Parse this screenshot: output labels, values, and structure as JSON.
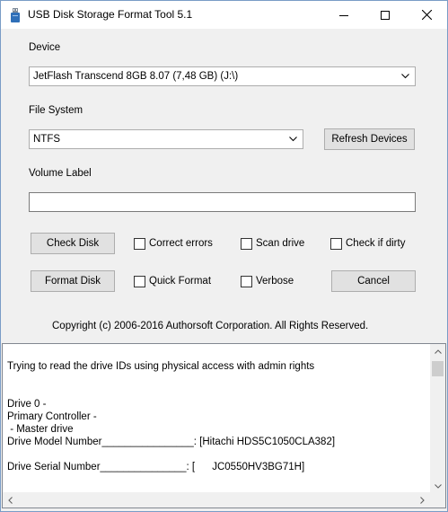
{
  "window": {
    "title": "USB Disk Storage Format Tool 5.1"
  },
  "form": {
    "device_label": "Device",
    "device_value": "JetFlash  Transcend 8GB  8.07 (7,48 GB) (J:\\)",
    "filesystem_label": "File System",
    "filesystem_value": "NTFS",
    "refresh_button": "Refresh Devices",
    "volume_label": "Volume Label",
    "volume_value": "",
    "check_disk_button": "Check Disk",
    "format_disk_button": "Format Disk",
    "cancel_button": "Cancel",
    "options": {
      "correct_errors": {
        "label": "Correct errors",
        "checked": false
      },
      "scan_drive": {
        "label": "Scan drive",
        "checked": false
      },
      "check_if_dirty": {
        "label": "Check if dirty",
        "checked": false
      },
      "quick_format": {
        "label": "Quick Format",
        "checked": false
      },
      "verbose": {
        "label": "Verbose",
        "checked": false
      }
    },
    "copyright": "Copyright (c) 2006-2016 Authorsoft Corporation. All Rights Reserved."
  },
  "log": {
    "lines": [
      "Trying to read the drive IDs using physical access with admin rights",
      "",
      "",
      "Drive 0 -",
      "Primary Controller -",
      " - Master drive",
      "Drive Model Number________________: [Hitachi HDS5C1050CLA382]",
      "",
      "Drive Serial Number_______________: [      JC0550HV3BG71H]"
    ]
  }
}
